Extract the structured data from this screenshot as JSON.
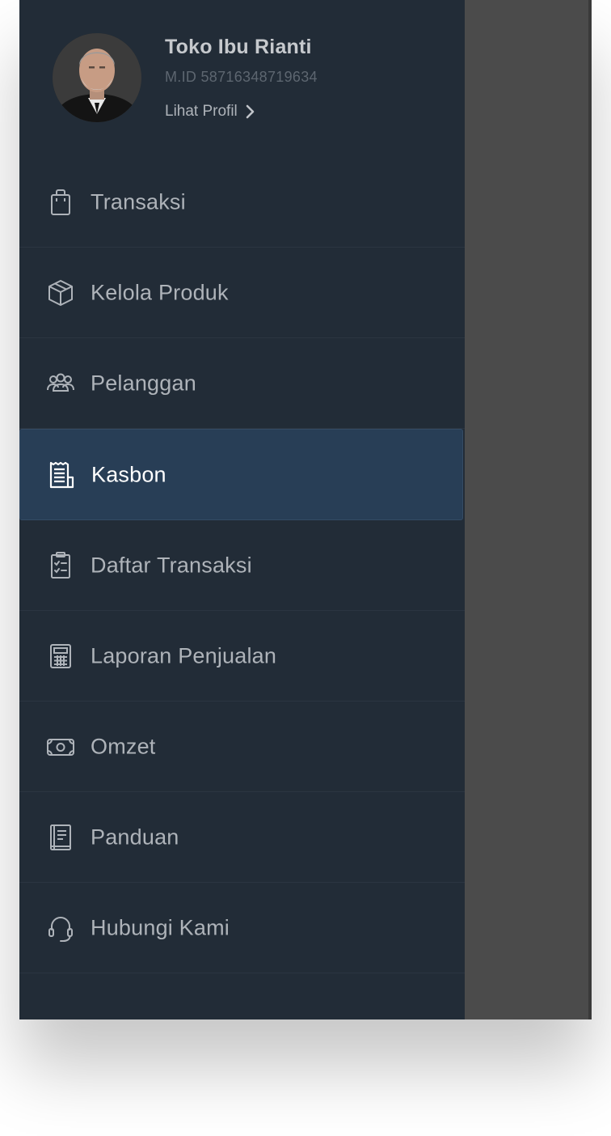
{
  "profile": {
    "store_name": "Toko Ibu Rianti",
    "merchant_id": "M.ID 58716348719634",
    "profile_link_label": "Lihat Profil"
  },
  "menu": {
    "active_index": 3,
    "items": [
      {
        "label": "Transaksi",
        "icon": "shopping-bag-icon"
      },
      {
        "label": "Kelola Produk",
        "icon": "box-icon"
      },
      {
        "label": "Pelanggan",
        "icon": "customers-icon"
      },
      {
        "label": "Kasbon",
        "icon": "receipt-icon"
      },
      {
        "label": "Daftar Transaksi",
        "icon": "checklist-icon"
      },
      {
        "label": "Laporan Penjualan",
        "icon": "calculator-icon"
      },
      {
        "label": "Omzet",
        "icon": "cash-icon"
      },
      {
        "label": "Panduan",
        "icon": "guide-book-icon"
      },
      {
        "label": "Hubungi Kami",
        "icon": "headset-icon"
      }
    ]
  },
  "colors": {
    "drawer_bg": "#222c37",
    "active_bg": "#283e56",
    "overlay": "#4b4b4b",
    "text_muted": "#aeb3b9",
    "text_active": "#ffffff"
  }
}
